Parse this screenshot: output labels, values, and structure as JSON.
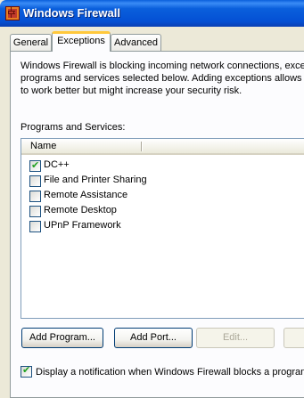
{
  "window": {
    "title": "Windows Firewall",
    "icon": "firewall-icon"
  },
  "tabs": [
    {
      "label": "General"
    },
    {
      "label": "Exceptions"
    },
    {
      "label": "Advanced"
    }
  ],
  "active_tab": "Exceptions",
  "description": {
    "line1": "Windows Firewall is blocking incoming network connections, excep",
    "line2": "programs and services selected below. Adding exceptions allows sc",
    "line3": "to work better but might increase your security risk."
  },
  "programs_label": "Programs and Services:",
  "list": {
    "column_name": "Name",
    "items": [
      {
        "label": "DC++",
        "checked": true
      },
      {
        "label": "File and Printer Sharing",
        "checked": false
      },
      {
        "label": "Remote Assistance",
        "checked": false
      },
      {
        "label": "Remote Desktop",
        "checked": false
      },
      {
        "label": "UPnP Framework",
        "checked": false
      }
    ]
  },
  "buttons": {
    "add_program": "Add Program...",
    "add_port": "Add Port...",
    "edit": "Edit...",
    "delete": ""
  },
  "notification": {
    "label": "Display a notification when Windows Firewall blocks a program",
    "checked": true
  }
}
